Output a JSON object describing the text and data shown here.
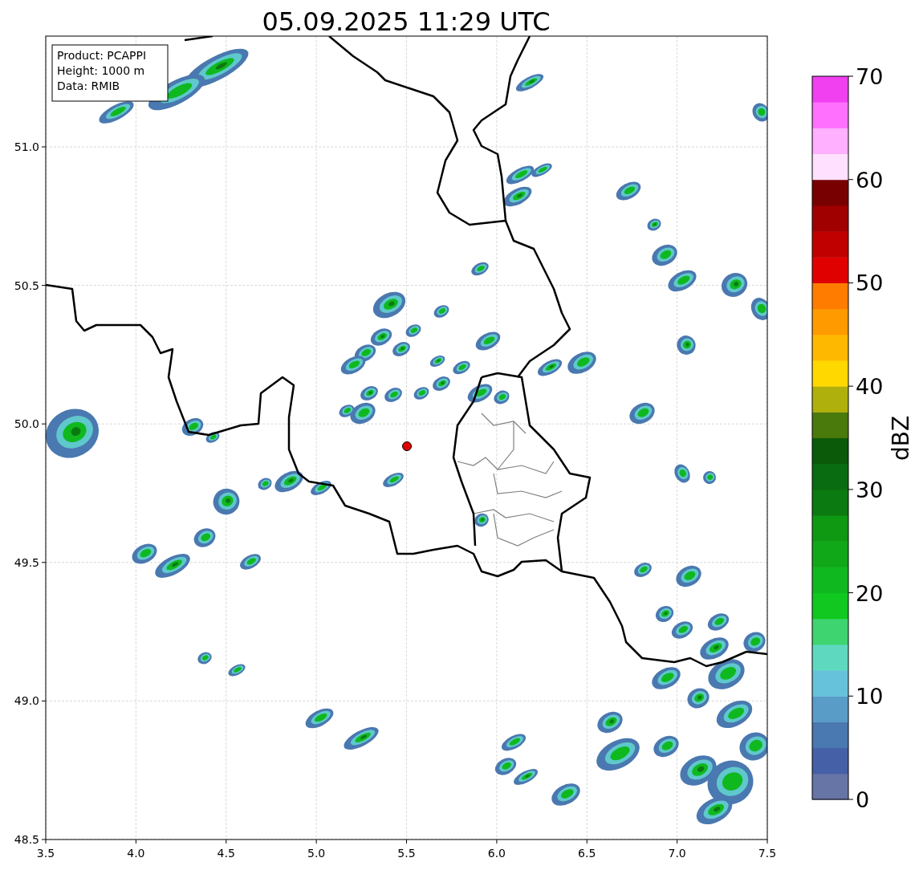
{
  "title": "05.09.2025 11:29 UTC",
  "info_box": [
    "Product: PCAPPI",
    "Height: 1000 m",
    "Data: RMIB"
  ],
  "x_ticks": [
    "3.5",
    "4.0",
    "4.5",
    "5.0",
    "5.5",
    "6.0",
    "6.5",
    "7.0",
    "7.5"
  ],
  "y_ticks": [
    "51.0",
    "50.5",
    "50.0",
    "49.5",
    "49.0",
    "48.5"
  ],
  "colorbar": {
    "label": "dBZ",
    "ticks": [
      "70",
      "60",
      "50",
      "40",
      "30",
      "20",
      "10",
      "0"
    ],
    "bands": [
      {
        "color": "#6774a6"
      },
      {
        "color": "#4560a6"
      },
      {
        "color": "#4a78b0"
      },
      {
        "color": "#5a9cc8"
      },
      {
        "color": "#66c2da"
      },
      {
        "color": "#5fd8c0"
      },
      {
        "color": "#3ed470"
      },
      {
        "color": "#10c820"
      },
      {
        "color": "#10b820"
      },
      {
        "color": "#10a818"
      },
      {
        "color": "#0f9812"
      },
      {
        "color": "#0b7a10"
      },
      {
        "color": "#0a6c10"
      },
      {
        "color": "#0a5a0a"
      },
      {
        "color": "#4a7a0c"
      },
      {
        "color": "#b0b00c"
      },
      {
        "color": "#ffd800"
      },
      {
        "color": "#ffb800"
      },
      {
        "color": "#ff9a00"
      },
      {
        "color": "#ff7c00"
      },
      {
        "color": "#e00000"
      },
      {
        "color": "#c00000"
      },
      {
        "color": "#a00000"
      },
      {
        "color": "#780000"
      },
      {
        "color": "#ffe0ff"
      },
      {
        "color": "#ffb0ff"
      },
      {
        "color": "#ff70ff"
      },
      {
        "color": "#f040f0"
      }
    ]
  }
}
